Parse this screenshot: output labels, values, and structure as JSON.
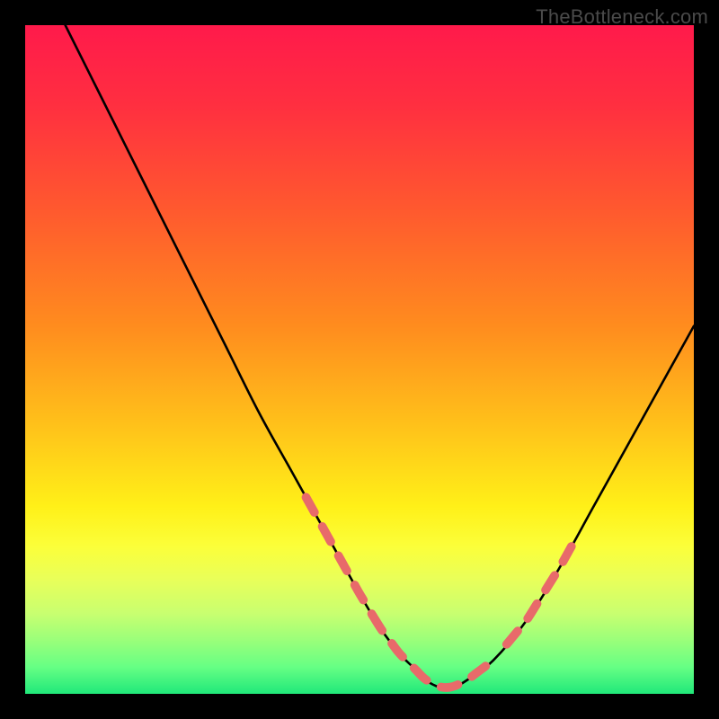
{
  "watermark": "TheBottleneck.com",
  "colors": {
    "frame": "#000000",
    "curve": "#000000",
    "dash": "#e86a6a",
    "gradient_stops": [
      {
        "offset": 0.0,
        "color": "#ff1a4b"
      },
      {
        "offset": 0.12,
        "color": "#ff2f40"
      },
      {
        "offset": 0.28,
        "color": "#ff5a2e"
      },
      {
        "offset": 0.45,
        "color": "#ff8c1e"
      },
      {
        "offset": 0.6,
        "color": "#ffc21a"
      },
      {
        "offset": 0.72,
        "color": "#fff018"
      },
      {
        "offset": 0.78,
        "color": "#fbff3a"
      },
      {
        "offset": 0.83,
        "color": "#e8ff5a"
      },
      {
        "offset": 0.88,
        "color": "#c8ff70"
      },
      {
        "offset": 0.92,
        "color": "#9aff7a"
      },
      {
        "offset": 0.96,
        "color": "#66ff84"
      },
      {
        "offset": 1.0,
        "color": "#20e87a"
      }
    ]
  },
  "chart_data": {
    "type": "line",
    "title": "",
    "xlabel": "",
    "ylabel": "",
    "xlim": [
      0,
      100
    ],
    "ylim": [
      0,
      100
    ],
    "series": [
      {
        "name": "bottleneck-curve",
        "x": [
          6,
          10,
          15,
          20,
          25,
          30,
          35,
          40,
          45,
          50,
          53,
          56,
          58,
          60,
          62,
          64,
          66,
          70,
          75,
          80,
          85,
          90,
          95,
          100
        ],
        "y": [
          100,
          92,
          82,
          72,
          62,
          52,
          42,
          33,
          24,
          15,
          10,
          6,
          4,
          2,
          1,
          1,
          2,
          5,
          11,
          19,
          28,
          37,
          46,
          55
        ]
      }
    ],
    "highlight_segments": [
      {
        "x_start": 42,
        "x_end": 52,
        "note": "left descending dashed band"
      },
      {
        "x_start": 52,
        "x_end": 70,
        "note": "valley dashed band"
      },
      {
        "x_start": 72,
        "x_end": 82,
        "note": "right ascending dashed band"
      }
    ],
    "minimum": {
      "x": 63,
      "y": 1
    }
  }
}
